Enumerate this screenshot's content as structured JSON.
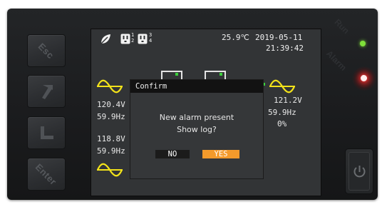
{
  "keys": {
    "esc": "Esc",
    "up_icon": "arrow-up-icon",
    "down_icon": "arrow-down-icon",
    "enter": "Enter"
  },
  "status_bar": {
    "leaf_icon": "eco-leaf-icon",
    "outlet_icon": "outlet-icon",
    "outlet_group_1": "1",
    "outlet_group_2": "2",
    "outlet_group_3": "3",
    "outlet_group_4": "4",
    "temperature": "25.9℃",
    "date": "2019-05-11",
    "time": "21:39:42"
  },
  "input": {
    "voltage": "120.4V",
    "frequency": "59.9Hz"
  },
  "bypass": {
    "voltage": "118.8V",
    "frequency": "59.9Hz"
  },
  "output": {
    "voltage": "121.2V",
    "frequency": "59.9Hz",
    "load": "0%"
  },
  "dialog": {
    "title": "Confirm",
    "message_line1": "New alarm present",
    "message_line2": "Show log?",
    "no_label": "NO",
    "yes_label": "YES"
  },
  "indicators": {
    "run_label": "Run",
    "alarm_label": "Alarm",
    "run_color": "#7fe03a",
    "alarm_color": "#ff3b3b"
  },
  "colors": {
    "sine_wave": "#f2e21a",
    "yes_button": "#f39a2b",
    "screen_bg": "#323436"
  }
}
